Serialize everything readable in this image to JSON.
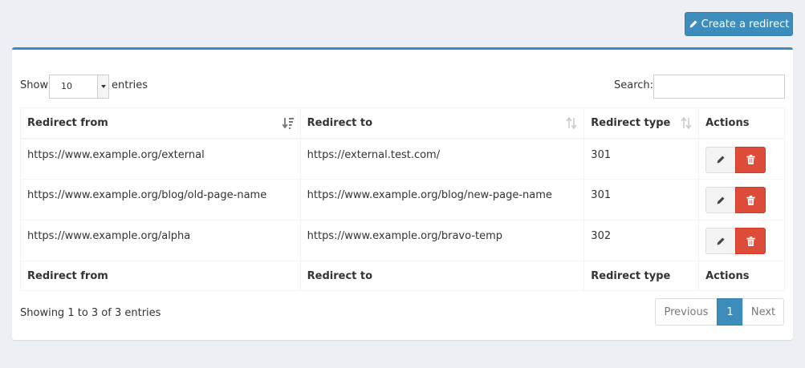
{
  "header": {
    "create_button_label": "Create a redirect"
  },
  "controls": {
    "show_label": "Show",
    "page_length": "10",
    "entries_label": "entries",
    "search_label": "Search:",
    "search_value": ""
  },
  "table": {
    "columns": [
      "Redirect from",
      "Redirect to",
      "Redirect type",
      "Actions"
    ],
    "rows": [
      {
        "from": "https://www.example.org/external",
        "to": "https://external.test.com/",
        "type": "301"
      },
      {
        "from": "https://www.example.org/blog/old-page-name",
        "to": "https://www.example.org/blog/new-page-name",
        "type": "301"
      },
      {
        "from": "https://www.example.org/alpha",
        "to": "https://www.example.org/bravo-temp",
        "type": "302"
      }
    ]
  },
  "footer": {
    "info": "Showing 1 to 3 of 3 entries",
    "prev_label": "Previous",
    "current_page": "1",
    "next_label": "Next"
  },
  "colors": {
    "primary": "#3c8dbc",
    "danger": "#dd4b39",
    "background": "#ecf0f5"
  },
  "icons": {
    "create": "pencil-icon",
    "edit": "pencil-icon",
    "delete": "trash-icon",
    "sort_active": "sort-amount-desc-icon",
    "sort": "sort-both-icon"
  }
}
